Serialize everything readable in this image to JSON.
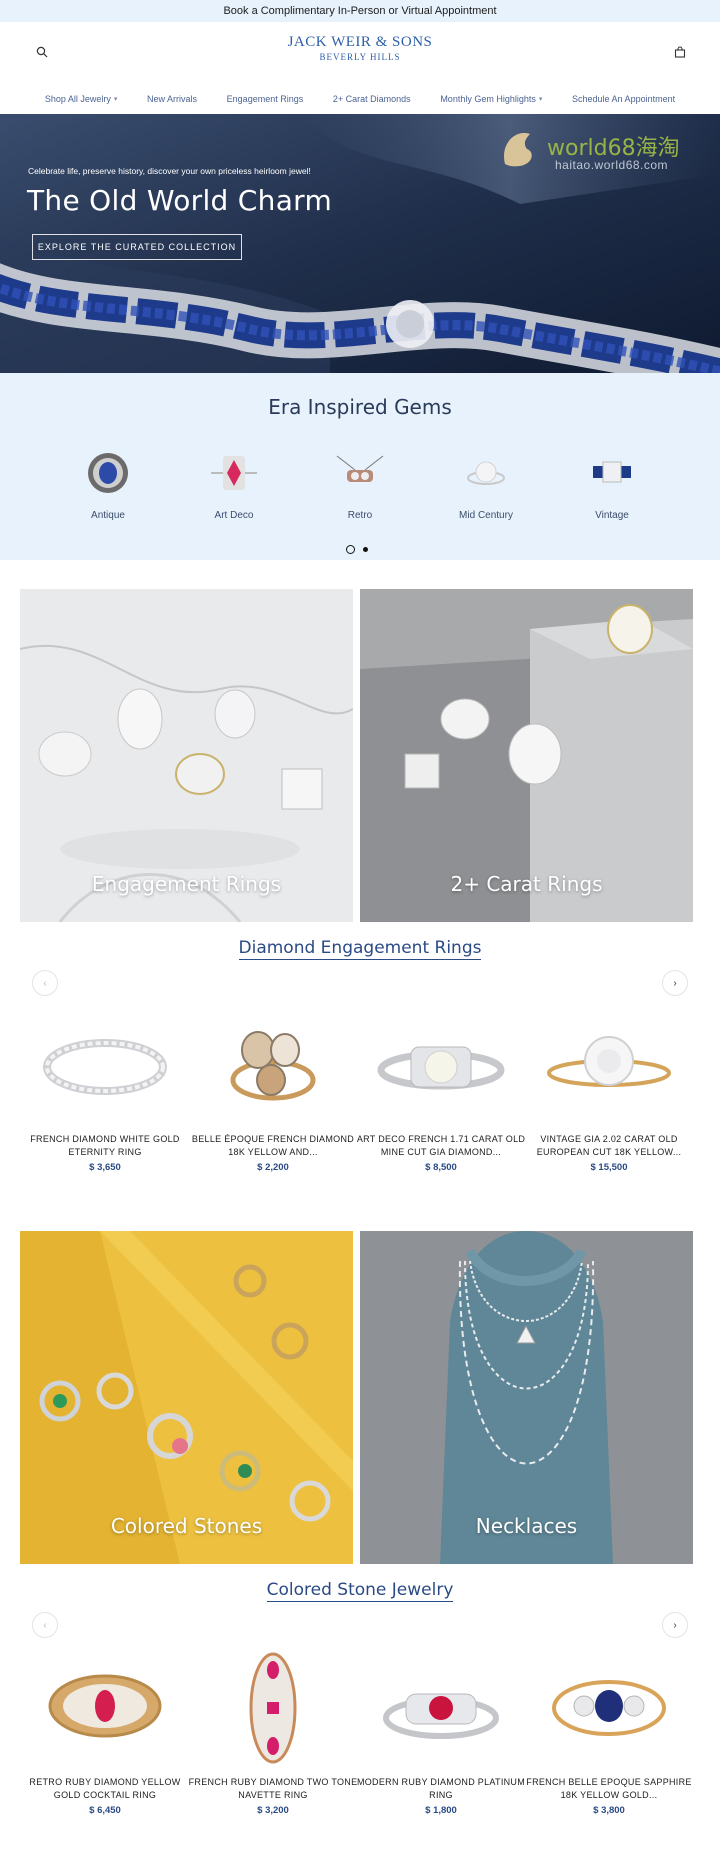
{
  "announcement": "Book a Complimentary In-Person or Virtual Appointment",
  "header": {
    "logo_line1": "JACK WEIR & SONS",
    "logo_line2": "BEVERLY HILLS",
    "search_icon": "search-icon",
    "bag_icon": "shopping-bag-icon"
  },
  "nav": {
    "items": [
      {
        "label": "Shop All Jewelry",
        "has_dropdown": true
      },
      {
        "label": "New Arrivals",
        "has_dropdown": false
      },
      {
        "label": "Engagement Rings",
        "has_dropdown": false
      },
      {
        "label": "2+ Carat Diamonds",
        "has_dropdown": false
      },
      {
        "label": "Monthly Gem Highlights",
        "has_dropdown": true
      },
      {
        "label": "Schedule An Appointment",
        "has_dropdown": false
      }
    ]
  },
  "hero": {
    "tagline": "Celebrate life, preserve history, discover your own priceless heirloom jewel!",
    "title": "The Old World Charm",
    "cta": "EXPLORE THE CURATED COLLECTION",
    "watermark_text": "world68海淘",
    "watermark_sub": "haitao.world68.com"
  },
  "era": {
    "title": "Era Inspired Gems",
    "items": [
      {
        "label": "Antique"
      },
      {
        "label": "Art Deco"
      },
      {
        "label": "Retro"
      },
      {
        "label": "Mid Century"
      },
      {
        "label": "Vintage"
      }
    ],
    "slide_count": 2,
    "active_slide": 1
  },
  "tiles_row1": [
    {
      "label": "Engagement Rings"
    },
    {
      "label": "2+ Carat Rings"
    }
  ],
  "diamond_section": {
    "title": "Diamond Engagement Rings",
    "products": [
      {
        "name": "FRENCH DIAMOND WHITE GOLD ETERNITY RING",
        "price": "$ 3,650"
      },
      {
        "name": "BELLE ÉPOQUE FRENCH DIAMOND 18K YELLOW AND...",
        "price": "$ 2,200"
      },
      {
        "name": "ART DECO FRENCH 1.71 CARAT OLD MINE CUT GIA DIAMOND...",
        "price": "$ 8,500"
      },
      {
        "name": "VINTAGE GIA 2.02 CARAT OLD EUROPEAN CUT 18K YELLOW...",
        "price": "$ 15,500"
      }
    ]
  },
  "tiles_row2": [
    {
      "label": "Colored Stones"
    },
    {
      "label": "Necklaces"
    }
  ],
  "colored_section": {
    "title": "Colored Stone Jewelry",
    "products": [
      {
        "name": "RETRO RUBY DIAMOND YELLOW GOLD COCKTAIL RING",
        "price": "$ 6,450"
      },
      {
        "name": "FRENCH RUBY DIAMOND TWO TONE NAVETTE RING",
        "price": "$ 3,200"
      },
      {
        "name": "MODERN RUBY DIAMOND PLATINUM RING",
        "price": "$ 1,800"
      },
      {
        "name": "FRENCH BELLE EPOQUE SAPPHIRE 18K YELLOW GOLD...",
        "price": "$ 3,800"
      }
    ]
  },
  "colors": {
    "accent": "#2a4a86",
    "light_blue_bg": "#e7f2fc",
    "hero_navy": "#1f2e4a"
  }
}
